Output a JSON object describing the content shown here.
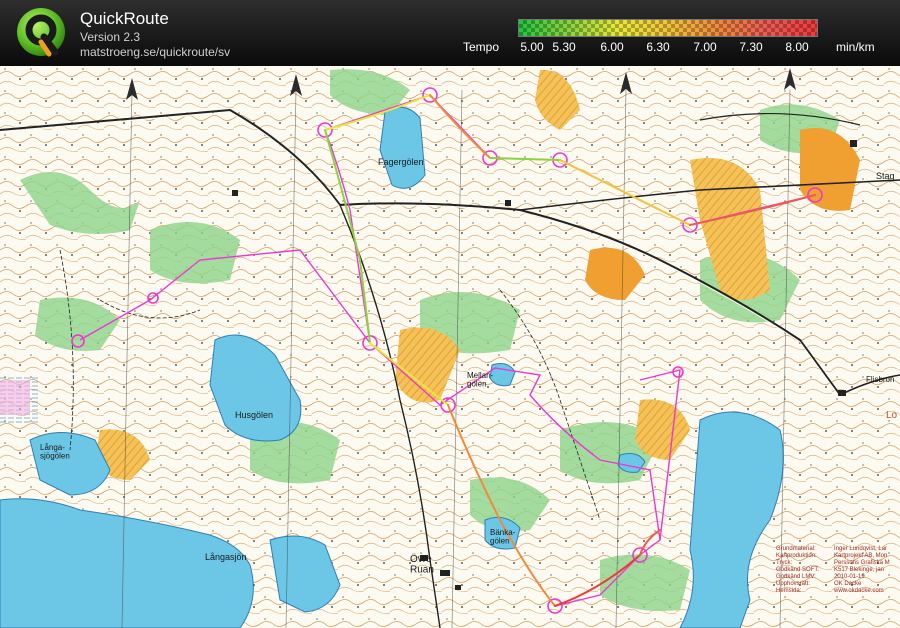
{
  "app": {
    "title": "QuickRoute",
    "version": "Version 2.3",
    "url": "matstroeng.se/quickroute/sv"
  },
  "tempo_scale": {
    "label": "Tempo",
    "ticks": [
      "5.00",
      "5.30",
      "6.00",
      "6.30",
      "7.00",
      "7.30",
      "8.00"
    ],
    "unit": "min/km",
    "colors": [
      "#22c43f",
      "#88d53d",
      "#e8e83a",
      "#f1c43a",
      "#f08a3c",
      "#ee5a52",
      "#ee3a3a"
    ]
  },
  "map": {
    "place_labels": {
      "fagergolen": "Fagergölen",
      "husgolen": "Husgölen",
      "langasjogolen": "Långa-\nsjögölen",
      "langasjon": "Långasjön",
      "mellangolen": "Mellan-\ngölen",
      "bankagolen": "Bänka-\ngölen",
      "ovre_ruan": "Övre\nRuan",
      "stage": "Stag",
      "flisbron": "Flisbron",
      "lo": "Lo"
    },
    "legend": [
      {
        "key": "Grundmaterial:",
        "value": "Inger Lundqvist, Lar"
      },
      {
        "key": "Kartproduktion:",
        "value": "Kartprojekt AB, Mon"
      },
      {
        "key": "Tryck:",
        "value": "Perssons Grafiska M"
      },
      {
        "key": "Godkänd SOFT:",
        "value": "K517 Blekinge, jan"
      },
      {
        "key": "Godkänd LMV:",
        "value": "2010-01-19"
      },
      {
        "key": "Upphovsrätt:",
        "value": "OK Dacke"
      },
      {
        "key": "Hemsida:",
        "value": "www.okdacke.com"
      }
    ],
    "colors": {
      "water": "#6cc7e6",
      "vegetation": "#8dd48a",
      "open_land": "#f1b23c",
      "contour": "#c8822f",
      "route": "#e83ad2",
      "road": "#222222"
    }
  }
}
